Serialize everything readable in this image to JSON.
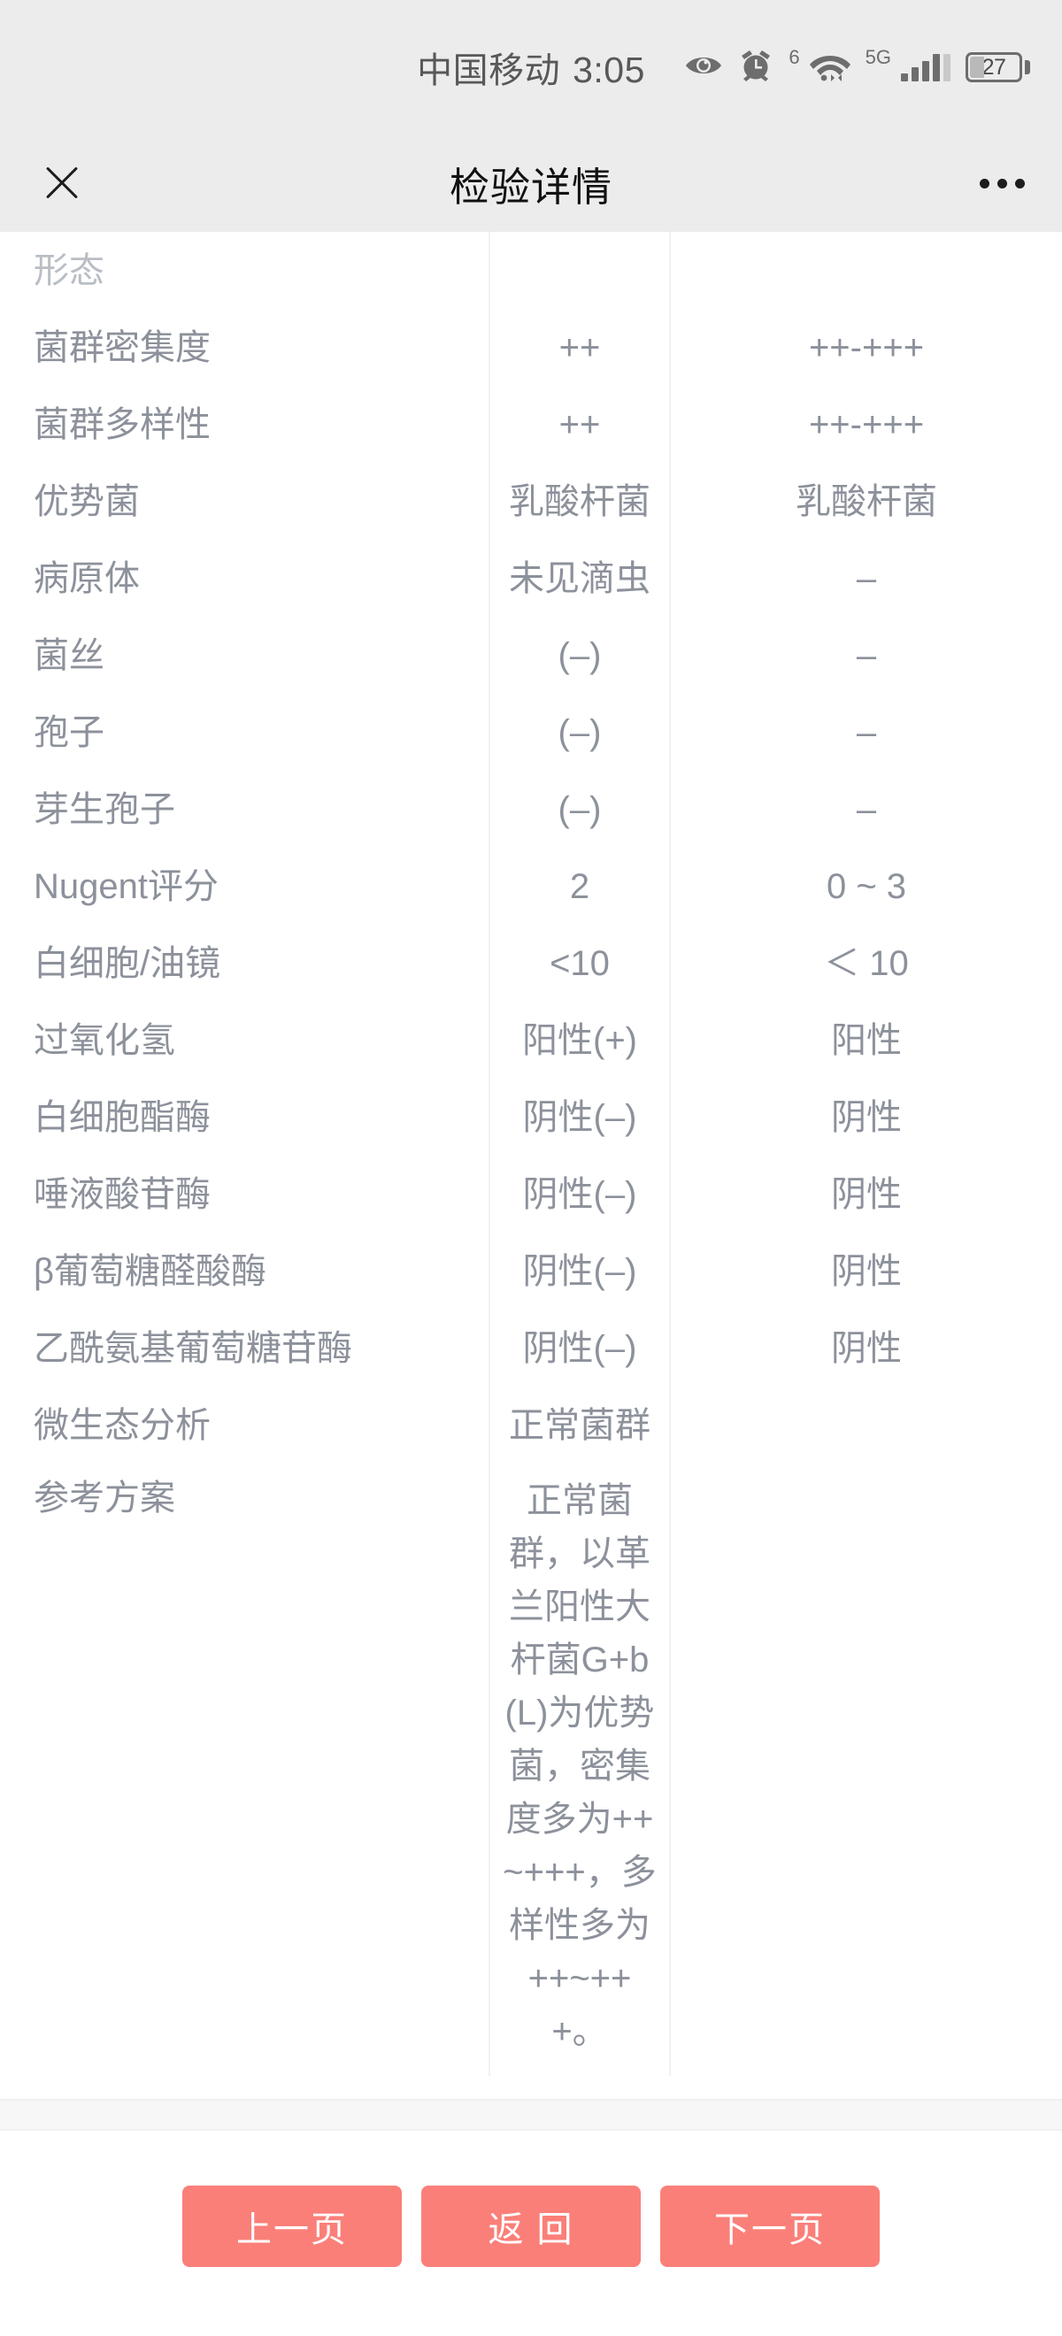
{
  "statusbar": {
    "carrier": "中国移动",
    "time": "3:05",
    "icons": [
      "eye-icon",
      "alarm-clock-icon",
      "wifi-icon",
      "cellular-signal-icon",
      "battery-icon"
    ],
    "wifi_generation": "6",
    "network_type": "5G",
    "battery_percent": "27"
  },
  "navbar": {
    "close_label": "关闭",
    "title": "检验详情",
    "more_label": "更多"
  },
  "table": {
    "clipped_top_row": {
      "name": "形态",
      "value": "",
      "reference": ""
    },
    "rows": [
      {
        "name": "菌群密集度",
        "value": "++",
        "reference": "++-+++"
      },
      {
        "name": "菌群多样性",
        "value": "++",
        "reference": "++-+++"
      },
      {
        "name": "优势菌",
        "value": "乳酸杆菌",
        "reference": "乳酸杆菌"
      },
      {
        "name": "病原体",
        "value": "未见滴虫",
        "reference": "–"
      },
      {
        "name": "菌丝",
        "value": "(–)",
        "reference": "–"
      },
      {
        "name": "孢子",
        "value": "(–)",
        "reference": "–"
      },
      {
        "name": "芽生孢子",
        "value": "(–)",
        "reference": "–"
      },
      {
        "name": "Nugent评分",
        "value": "2",
        "reference": "0 ~ 3"
      },
      {
        "name": "白细胞/油镜",
        "value": "<10",
        "reference": "＜ 10"
      },
      {
        "name": "过氧化氢",
        "value": "阳性(+)",
        "reference": "阳性"
      },
      {
        "name": "白细胞酯酶",
        "value": "阴性(–)",
        "reference": "阴性"
      },
      {
        "name": "唾液酸苷酶",
        "value": "阴性(–)",
        "reference": "阴性"
      },
      {
        "name": "β葡萄糖醛酸酶",
        "value": "阴性(–)",
        "reference": "阴性"
      },
      {
        "name": "乙酰氨基葡萄糖苷酶",
        "value": "阴性(–)",
        "reference": "阴性"
      },
      {
        "name": "微生态分析",
        "value": "正常菌群",
        "reference": ""
      }
    ],
    "long_row": {
      "name": "参考方案",
      "value": "正常菌群，以革兰阳性大杆菌G+b(L)为优势菌，密集度多为++~+++，多样性多为++~+++。",
      "reference": ""
    }
  },
  "footer": {
    "prev_label": "上一页",
    "back_label": "返 回",
    "next_label": "下一页"
  },
  "colors": {
    "accent": "#fb7f79",
    "bar_background": "#ececec",
    "text_muted": "#8c919b",
    "divider": "#f0f1f2"
  }
}
